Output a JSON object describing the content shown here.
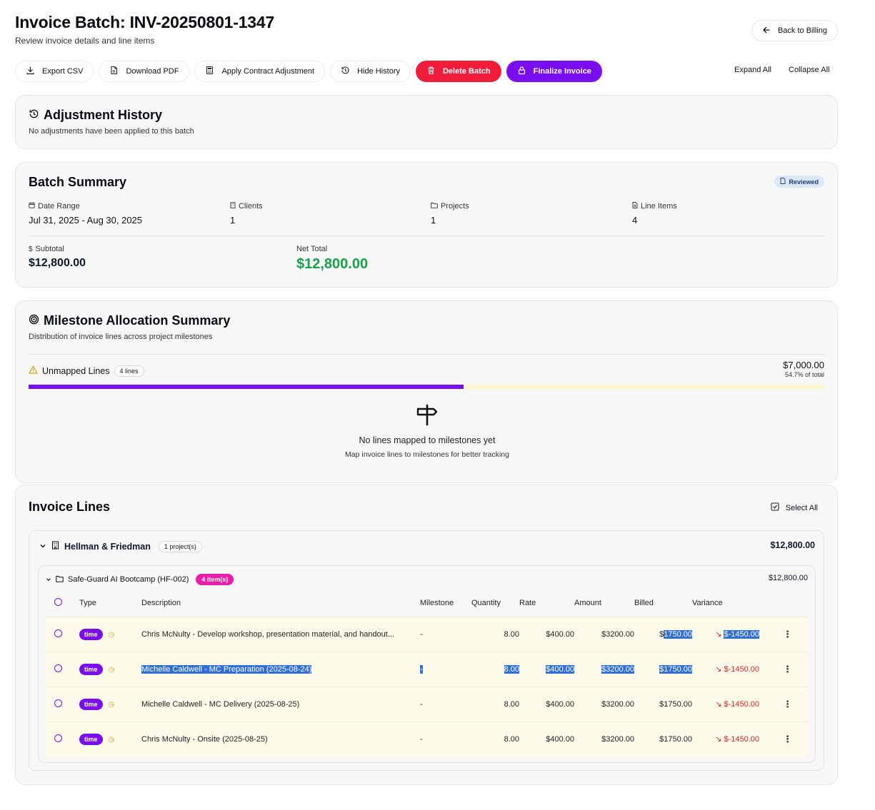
{
  "header": {
    "title": "Invoice Batch: INV-20250801-1347",
    "subtitle": "Review invoice details and line items",
    "back_label": "Back to Billing"
  },
  "toolbar": {
    "export_csv": "Export CSV",
    "download_pdf": "Download PDF",
    "apply_adjustment": "Apply Contract Adjustment",
    "hide_history": "Hide History",
    "delete_batch": "Delete Batch",
    "finalize": "Finalize Invoice",
    "expand_all": "Expand All",
    "collapse_all": "Collapse All"
  },
  "history": {
    "title": "Adjustment History",
    "empty": "No adjustments have been applied to this batch"
  },
  "summary": {
    "title": "Batch Summary",
    "status": "Reviewed",
    "date_range_label": "Date Range",
    "date_range": "Jul 31, 2025 - Aug 30, 2025",
    "clients_label": "Clients",
    "clients": "1",
    "projects_label": "Projects",
    "projects": "1",
    "line_items_label": "Line Items",
    "line_items": "4",
    "subtotal_label": "Subtotal",
    "subtotal": "$12,800.00",
    "net_total_label": "Net Total",
    "net_total": "$12,800.00"
  },
  "milestones": {
    "title": "Milestone Allocation Summary",
    "subtitle": "Distribution of invoice lines across project milestones",
    "unmapped_label": "Unmapped Lines",
    "unmapped_count": "4 lines",
    "unmapped_amount": "$7,000.00",
    "unmapped_pct_text": "54.7% of total",
    "progress_fraction": 0.547,
    "empty_title": "No lines mapped to milestones yet",
    "empty_sub": "Map invoice lines to milestones for better tracking"
  },
  "invoice_lines": {
    "title": "Invoice Lines",
    "select_all": "Select All",
    "client": {
      "name": "Hellman & Friedman",
      "projects_badge": "1 project(s)",
      "total": "$12,800.00",
      "project": {
        "name": "Safe-Guard AI Bootcamp (HF-002)",
        "items_badge": "4 item(s)",
        "total": "$12,800.00"
      }
    },
    "columns": {
      "type": "Type",
      "description": "Description",
      "milestone": "Milestone",
      "quantity": "Quantity",
      "rate": "Rate",
      "amount": "Amount",
      "billed": "Billed",
      "variance": "Variance"
    },
    "rows": [
      {
        "type": "time",
        "description": "Chris McNulty - Develop workshop, presentation material, and handout...",
        "milestone": "-",
        "quantity": "8.00",
        "rate": "$400.00",
        "amount": "$3200.00",
        "billed_prefix": "$",
        "billed_rest": "1750.00",
        "variance": "$-1450.00"
      },
      {
        "type": "time",
        "description": "Michelle Caldwell - MC Preparation (2025-08-24)",
        "milestone": "-",
        "quantity": "8.00",
        "rate": "$400.00",
        "amount": "$3200.00",
        "billed": "$1750.00",
        "variance": "$-1450.00"
      },
      {
        "type": "time",
        "description": "Michelle Caldwell - MC Delivery (2025-08-25)",
        "milestone": "-",
        "quantity": "8.00",
        "rate": "$400.00",
        "amount": "$3200.00",
        "billed": "$1750.00",
        "variance": "$-1450.00"
      },
      {
        "type": "time",
        "description": "Chris McNulty - Onsite (2025-08-25)",
        "milestone": "-",
        "quantity": "8.00",
        "rate": "$400.00",
        "amount": "$3200.00",
        "billed": "$1750.00",
        "variance": "$-1450.00"
      }
    ]
  },
  "colors": {
    "accent_purple": "#7b0ef0",
    "danger_red": "#ef1c3a",
    "net_total_green": "#16a34a",
    "row_highlight": "#fefbea",
    "progress_track": "#fdf6c9"
  }
}
